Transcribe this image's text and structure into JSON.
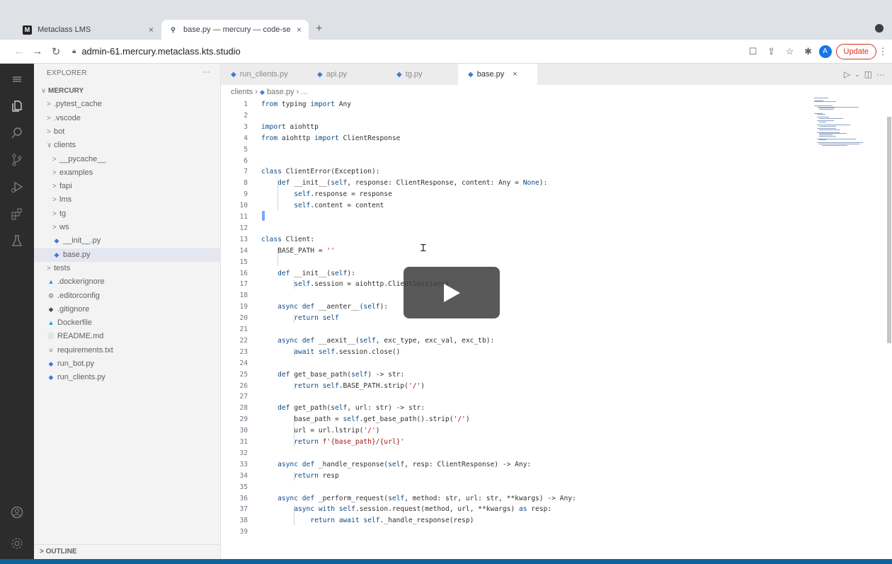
{
  "browser": {
    "tabs": [
      {
        "title": "Metaclass LMS",
        "favicon": "M"
      },
      {
        "title": "base.py — mercury — code-se",
        "favicon": "code-server-icon"
      }
    ],
    "new_tab": "+",
    "url": "admin-61.mercury.metaclass.kts.studio",
    "update_label": "Update",
    "avatar_letter": "A"
  },
  "sidebar": {
    "title": "EXPLORER",
    "more": "···",
    "outline": "> OUTLINE",
    "tree": [
      {
        "label": "MERCURY",
        "chev": "∨",
        "indent": 0,
        "icon": "",
        "root": true
      },
      {
        "label": ".pytest_cache",
        "chev": ">",
        "indent": 1,
        "icon": ""
      },
      {
        "label": ".vscode",
        "chev": ">",
        "indent": 1,
        "icon": ""
      },
      {
        "label": "bot",
        "chev": ">",
        "indent": 1,
        "icon": ""
      },
      {
        "label": "clients",
        "chev": "∨",
        "indent": 1,
        "icon": ""
      },
      {
        "label": "__pycache__",
        "chev": ">",
        "indent": 2,
        "icon": ""
      },
      {
        "label": "examples",
        "chev": ">",
        "indent": 2,
        "icon": ""
      },
      {
        "label": "fapi",
        "chev": ">",
        "indent": 2,
        "icon": ""
      },
      {
        "label": "lms",
        "chev": ">",
        "indent": 2,
        "icon": ""
      },
      {
        "label": "tg",
        "chev": ">",
        "indent": 2,
        "icon": ""
      },
      {
        "label": "ws",
        "chev": ">",
        "indent": 2,
        "icon": ""
      },
      {
        "label": "__init__.py",
        "chev": "",
        "indent": 2,
        "icon": "python"
      },
      {
        "label": "base.py",
        "chev": "",
        "indent": 2,
        "icon": "python",
        "selected": true
      },
      {
        "label": "tests",
        "chev": ">",
        "indent": 1,
        "icon": ""
      },
      {
        "label": ".dockerignore",
        "chev": "",
        "indent": 1,
        "icon": "docker"
      },
      {
        "label": ".editorconfig",
        "chev": "",
        "indent": 1,
        "icon": "gear"
      },
      {
        "label": ".gitignore",
        "chev": "",
        "indent": 1,
        "icon": "git"
      },
      {
        "label": "Dockerfile",
        "chev": "",
        "indent": 1,
        "icon": "docker"
      },
      {
        "label": "README.md",
        "chev": "",
        "indent": 1,
        "icon": "info"
      },
      {
        "label": "requirements.txt",
        "chev": "",
        "indent": 1,
        "icon": "text"
      },
      {
        "label": "run_bot.py",
        "chev": "",
        "indent": 1,
        "icon": "python"
      },
      {
        "label": "run_clients.py",
        "chev": "",
        "indent": 1,
        "icon": "python"
      }
    ]
  },
  "editor": {
    "tabs": [
      {
        "label": "run_clients.py"
      },
      {
        "label": "api.py"
      },
      {
        "label": "tg.py"
      },
      {
        "label": "base.py",
        "active": true
      }
    ],
    "close_glyph": "×",
    "breadcrumb": [
      "clients",
      "base.py",
      "..."
    ],
    "lines": [
      "from typing import Any",
      "",
      "import aiohttp",
      "from aiohttp import ClientResponse",
      "",
      "",
      "class ClientError(Exception):",
      "    def __init__(self, response: ClientResponse, content: Any = None):",
      "        self.response = response",
      "        self.content = content",
      "",
      "",
      "class Client:",
      "    BASE_PATH = ''",
      "",
      "    def __init__(self):",
      "        self.session = aiohttp.ClientSession()",
      "",
      "    async def __aenter__(self):",
      "        return self",
      "",
      "    async def __aexit__(self, exc_type, exc_val, exc_tb):",
      "        await self.session.close()",
      "",
      "    def get_base_path(self) -> str:",
      "        return self.BASE_PATH.strip('/')",
      "",
      "    def get_path(self, url: str) -> str:",
      "        base_path = self.get_base_path().strip('/')",
      "        url = url.lstrip('/')",
      "        return f'{base_path}/{url}'",
      "",
      "    async def _handle_response(self, resp: ClientResponse) -> Any:",
      "        return resp",
      "",
      "    async def _perform_request(self, method: str, url: str, **kwargs) -> Any:",
      "        async with self.session.request(method, url, **kwargs) as resp:",
      "            return await self._handle_response(resp)",
      ""
    ]
  },
  "colors": {
    "activity_bar": "#2c2c2c",
    "sidebar": "#f3f3f3",
    "statusbar": "#0e639c",
    "keyword": "#0f4a85",
    "string": "#a31515"
  }
}
